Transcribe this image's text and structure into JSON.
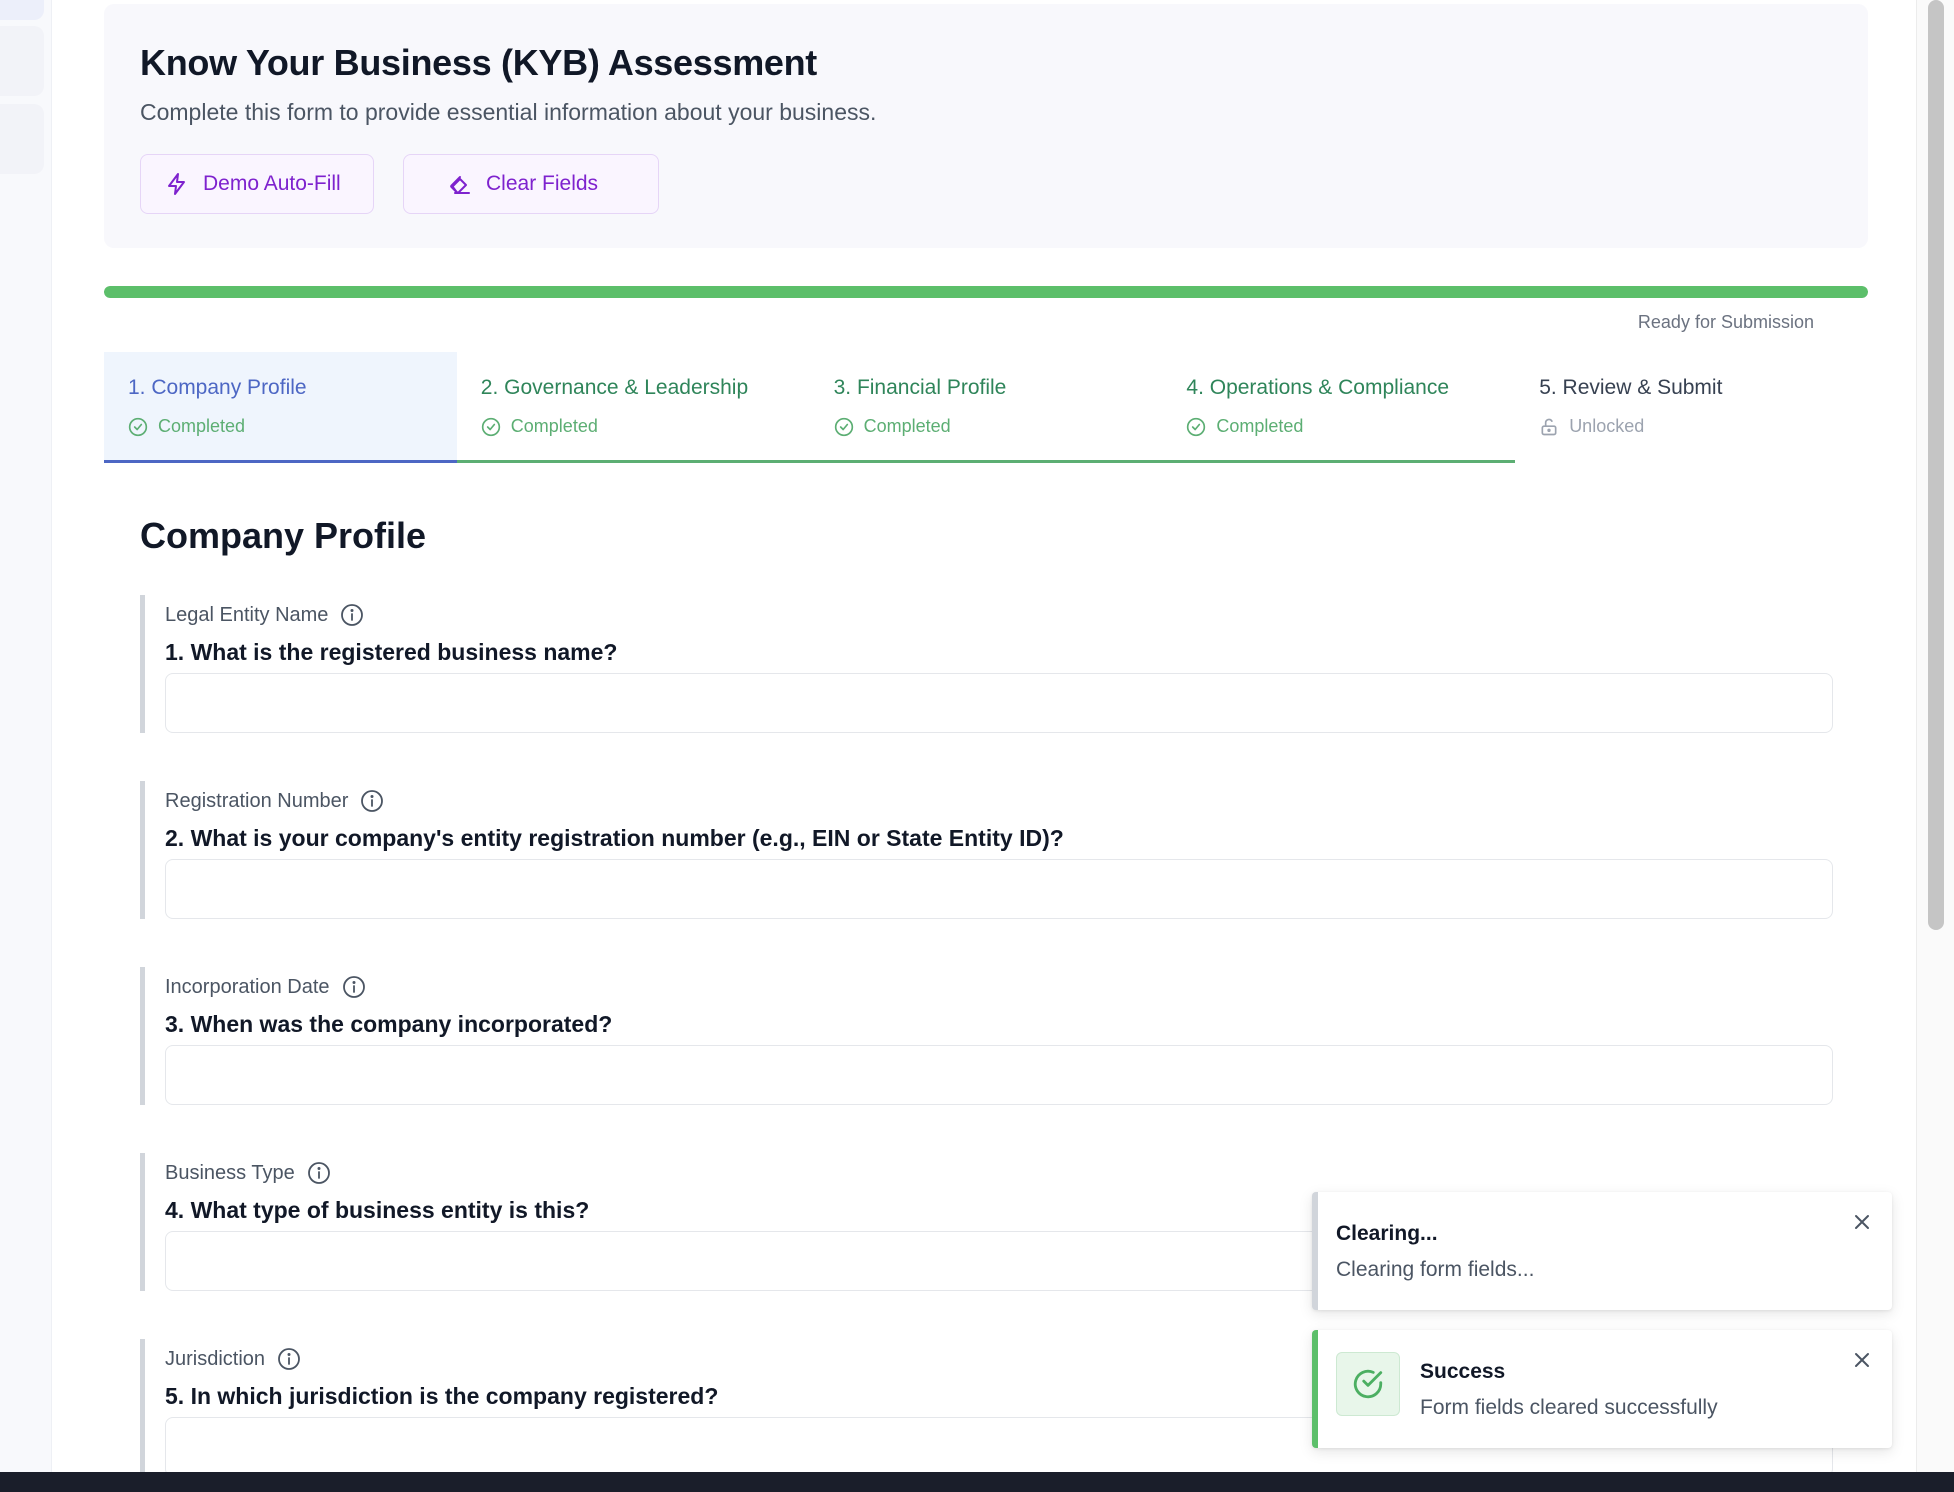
{
  "header": {
    "title": "Know Your Business (KYB) Assessment",
    "subtitle": "Complete this form to provide essential information about your business.",
    "buttons": {
      "autofill_label": "Demo Auto-Fill",
      "clear_label": "Clear Fields"
    }
  },
  "progress": {
    "percent": 100,
    "status": "Ready for Submission"
  },
  "tabs": [
    {
      "label": "1. Company Profile",
      "status": "Completed",
      "state": "active"
    },
    {
      "label": "2. Governance & Leadership",
      "status": "Completed",
      "state": "completed"
    },
    {
      "label": "3. Financial Profile",
      "status": "Completed",
      "state": "completed"
    },
    {
      "label": "4. Operations & Compliance",
      "status": "Completed",
      "state": "completed"
    },
    {
      "label": "5. Review & Submit",
      "status": "Unlocked",
      "state": "unlocked"
    }
  ],
  "section": {
    "title": "Company Profile",
    "fields": [
      {
        "label": "Legal Entity Name",
        "question": "1. What is the registered business name?",
        "value": ""
      },
      {
        "label": "Registration Number",
        "question": "2. What is your company's entity registration number (e.g., EIN or State Entity ID)?",
        "value": ""
      },
      {
        "label": "Incorporation Date",
        "question": "3. When was the company incorporated?",
        "value": ""
      },
      {
        "label": "Business Type",
        "question": "4. What type of business entity is this?",
        "value": ""
      },
      {
        "label": "Jurisdiction",
        "question": "5. In which jurisdiction is the company registered?",
        "value": ""
      }
    ]
  },
  "toasts": [
    {
      "title": "Clearing...",
      "message": "Clearing form fields..."
    },
    {
      "title": "Success",
      "message": "Form fields cleared successfully"
    }
  ],
  "colors": {
    "accent_purple": "#7e22ce",
    "success_green": "#5cbf6a",
    "active_tab_blue": "#4d67c4"
  }
}
